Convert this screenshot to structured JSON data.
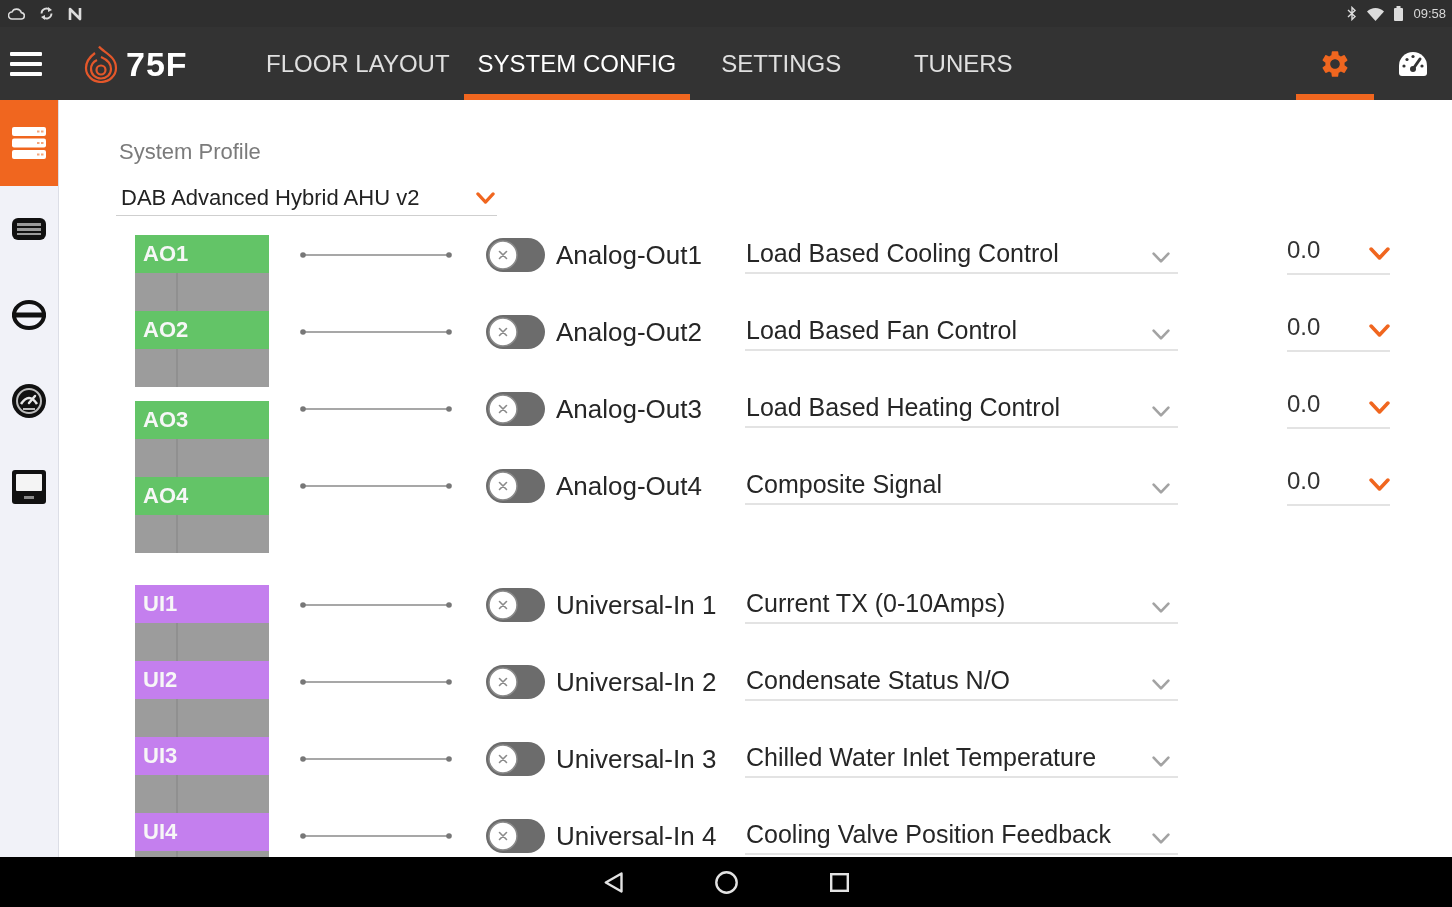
{
  "status_bar": {
    "time": "09:58"
  },
  "app_bar": {
    "logo": "75F",
    "tabs": [
      {
        "label": "FLOOR LAYOUT",
        "selected": false
      },
      {
        "label": "SYSTEM CONFIG",
        "selected": true
      },
      {
        "label": "SETTINGS",
        "selected": false
      },
      {
        "label": "TUNERS",
        "selected": false
      }
    ],
    "icon_tabs": [
      {
        "kind": "settings",
        "selected": true
      },
      {
        "kind": "dashboard",
        "selected": false
      }
    ]
  },
  "sidebar": {
    "items": [
      {
        "kind": "servers",
        "selected": true
      },
      {
        "kind": "device",
        "selected": false
      },
      {
        "kind": "circle_bar",
        "selected": false
      },
      {
        "kind": "gauge",
        "selected": false
      },
      {
        "kind": "display",
        "selected": false
      }
    ]
  },
  "system_profile": {
    "label": "System Profile",
    "value": "DAB Advanced Hybrid AHU v2"
  },
  "port_groups": [
    {
      "kind": "analog_out",
      "blocks": [
        {
          "ports": [
            "AO1",
            "AO2"
          ]
        },
        {
          "ports": [
            "AO3",
            "AO4"
          ]
        }
      ],
      "channels": [
        {
          "name": "Analog-Out1",
          "on": false,
          "mapping": "Load Based Cooling Control",
          "value": "0.0"
        },
        {
          "name": "Analog-Out2",
          "on": false,
          "mapping": "Load Based Fan Control",
          "value": "0.0"
        },
        {
          "name": "Analog-Out3",
          "on": false,
          "mapping": "Load Based Heating Control",
          "value": "0.0"
        },
        {
          "name": "Analog-Out4",
          "on": false,
          "mapping": "Composite Signal",
          "value": "0.0"
        }
      ]
    },
    {
      "kind": "universal_in",
      "blocks": [
        {
          "ports": [
            "UI1",
            "UI2",
            "UI3",
            "UI4"
          ]
        }
      ],
      "channels": [
        {
          "name": "Universal-In 1",
          "on": false,
          "mapping": "Current TX (0-10Amps)"
        },
        {
          "name": "Universal-In 2",
          "on": false,
          "mapping": "Condensate Status N/O"
        },
        {
          "name": "Universal-In 3",
          "on": false,
          "mapping": "Chilled Water Inlet Temperature"
        },
        {
          "name": "Universal-In 4",
          "on": false,
          "mapping": "Cooling Valve Position Feedback"
        }
      ]
    }
  ]
}
